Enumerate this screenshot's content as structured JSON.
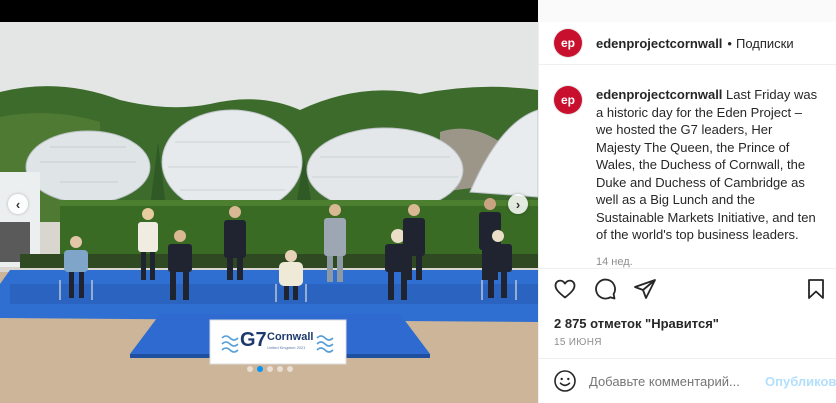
{
  "account": {
    "username": "edenprojectcornwall",
    "separator": "•",
    "follow_label": "Подписки",
    "avatar_text": "ep"
  },
  "caption": {
    "username": "edenprojectcornwall",
    "text": "Last Friday was a historic day for the Eden Project – we hosted the G7 leaders, Her Majesty The Queen, the Prince of Wales, the Duchess of Cornwall, the Duke and Duchess of Cambridge as well as a Big Lunch and the Sustainable Markets Initiative, and ten of the world's top business leaders.",
    "time": "14 нед."
  },
  "actions": {
    "likes": "2 875 отметок \"Нравится\"",
    "date": "15 ИЮНЯ"
  },
  "comment": {
    "placeholder": "Добавьте комментарий...",
    "publish_label": "Опубликовать"
  },
  "media": {
    "sign_brand": "G7",
    "sign_title": "Cornwall",
    "sign_subtitle": "United Kingdom 2021",
    "slide_count": 5,
    "active_slide": 2
  },
  "colors": {
    "brand": "#c8102e",
    "accent": "#0095f6",
    "muted": "#8e8e8e",
    "publish_disabled": "#b2dffc"
  }
}
